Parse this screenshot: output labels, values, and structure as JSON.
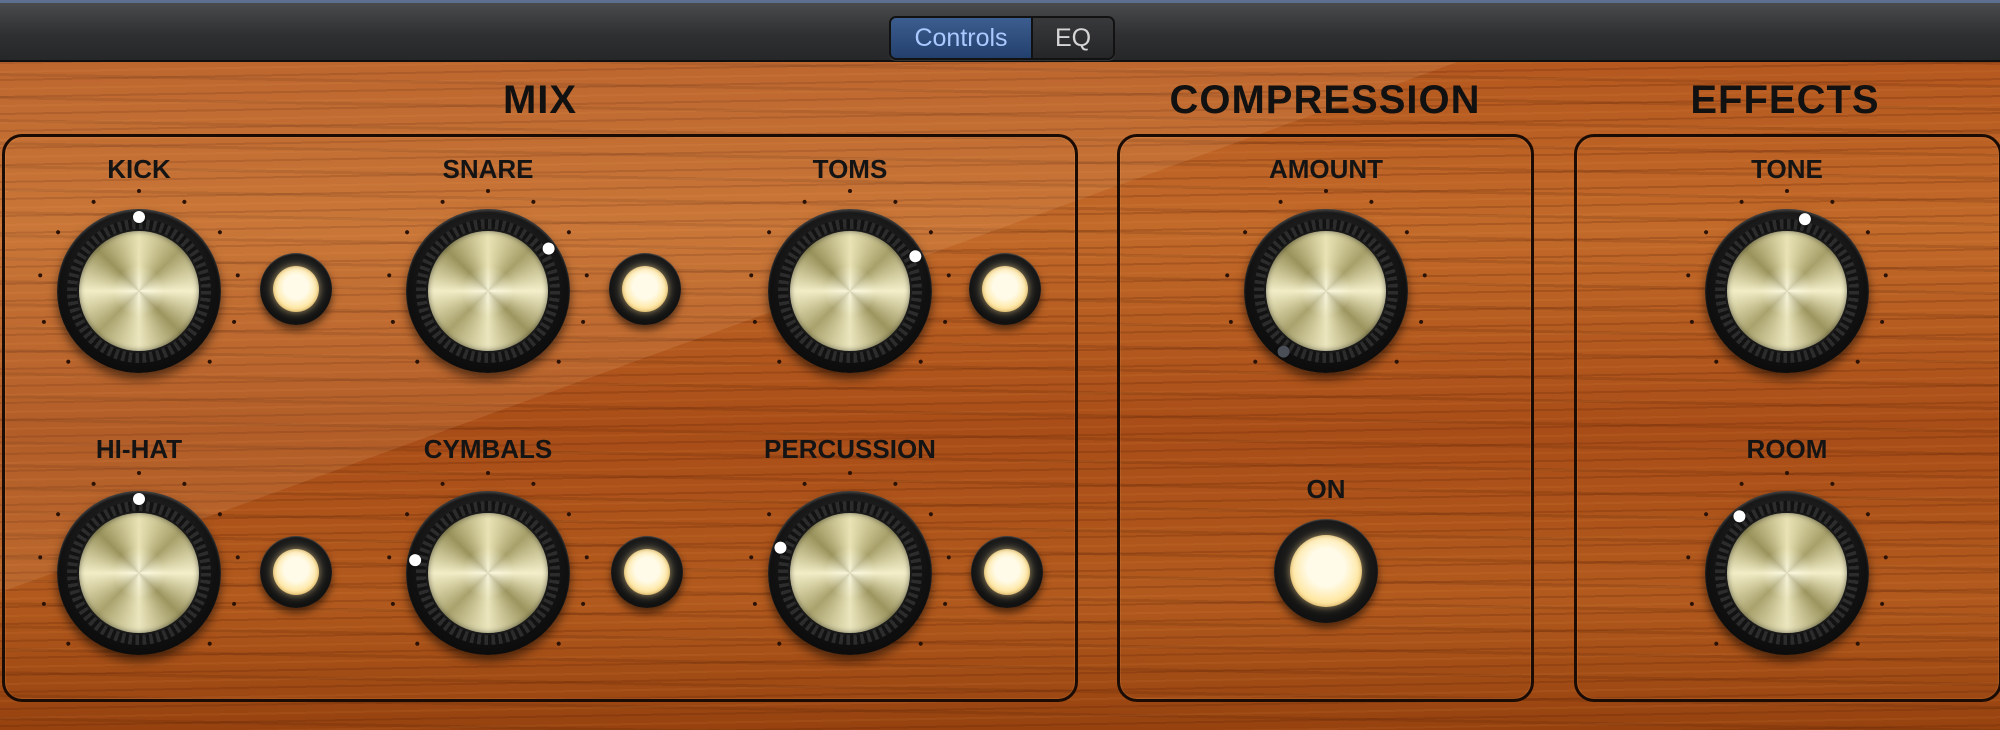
{
  "tabs": {
    "controls": "Controls",
    "eq": "EQ"
  },
  "sections": {
    "mix": {
      "title": "MIX"
    },
    "compression": {
      "title": "COMPRESSION"
    },
    "effects": {
      "title": "EFFECTS"
    }
  },
  "knobs": {
    "kick": {
      "label": "KICK"
    },
    "snare": {
      "label": "SNARE"
    },
    "toms": {
      "label": "TOMS"
    },
    "hihat": {
      "label": "HI-HAT"
    },
    "cymbals": {
      "label": "CYMBALS"
    },
    "percussion": {
      "label": "PERCUSSION"
    },
    "amount": {
      "label": "AMOUNT"
    },
    "tone": {
      "label": "TONE"
    },
    "room": {
      "label": "ROOM"
    }
  },
  "compression_switch": {
    "label": "ON"
  },
  "colors": {
    "active_tab": "#2f4f83",
    "led_on": "#ffefb8",
    "wood": "#b4581f"
  }
}
